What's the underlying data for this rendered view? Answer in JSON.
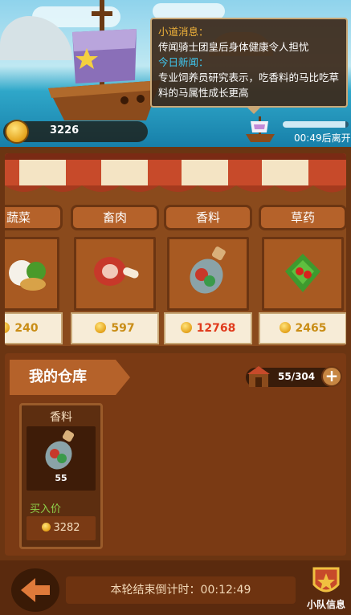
{
  "scene": {
    "coin_total": "3226",
    "news": {
      "gossip_heading": "小道消息：",
      "gossip_text": "传闻骑士团皇后身体健康令人担忧",
      "daily_heading": "今日新闻：",
      "daily_text": "专业饲养员研究表示，吃香料的马比吃草料的马属性成长更高"
    },
    "voyage_progress": 0.95,
    "departure_text": "00:49后离开"
  },
  "market": {
    "shelves": [
      {
        "name": "蔬菜",
        "price": "240",
        "icon": "vegetable-icon",
        "price_color": "#e0a51b"
      },
      {
        "name": "畜肉",
        "price": "597",
        "icon": "meat-icon",
        "price_color": "#e0a51b"
      },
      {
        "name": "香料",
        "price": "12768",
        "icon": "spice-bottle-icon",
        "price_color": "#e03a1c"
      },
      {
        "name": "草药",
        "price": "2465",
        "icon": "herb-icon",
        "price_color": "#e0a51b"
      }
    ]
  },
  "warehouse": {
    "title": "我的仓库",
    "capacity": "55/304",
    "item": {
      "name": "香料",
      "count": "55",
      "buy_label": "买入价",
      "buy_price": "3282"
    }
  },
  "bottom": {
    "countdown_text": "本轮结束倒计时：00:12:49",
    "team_label": "小队信息"
  }
}
